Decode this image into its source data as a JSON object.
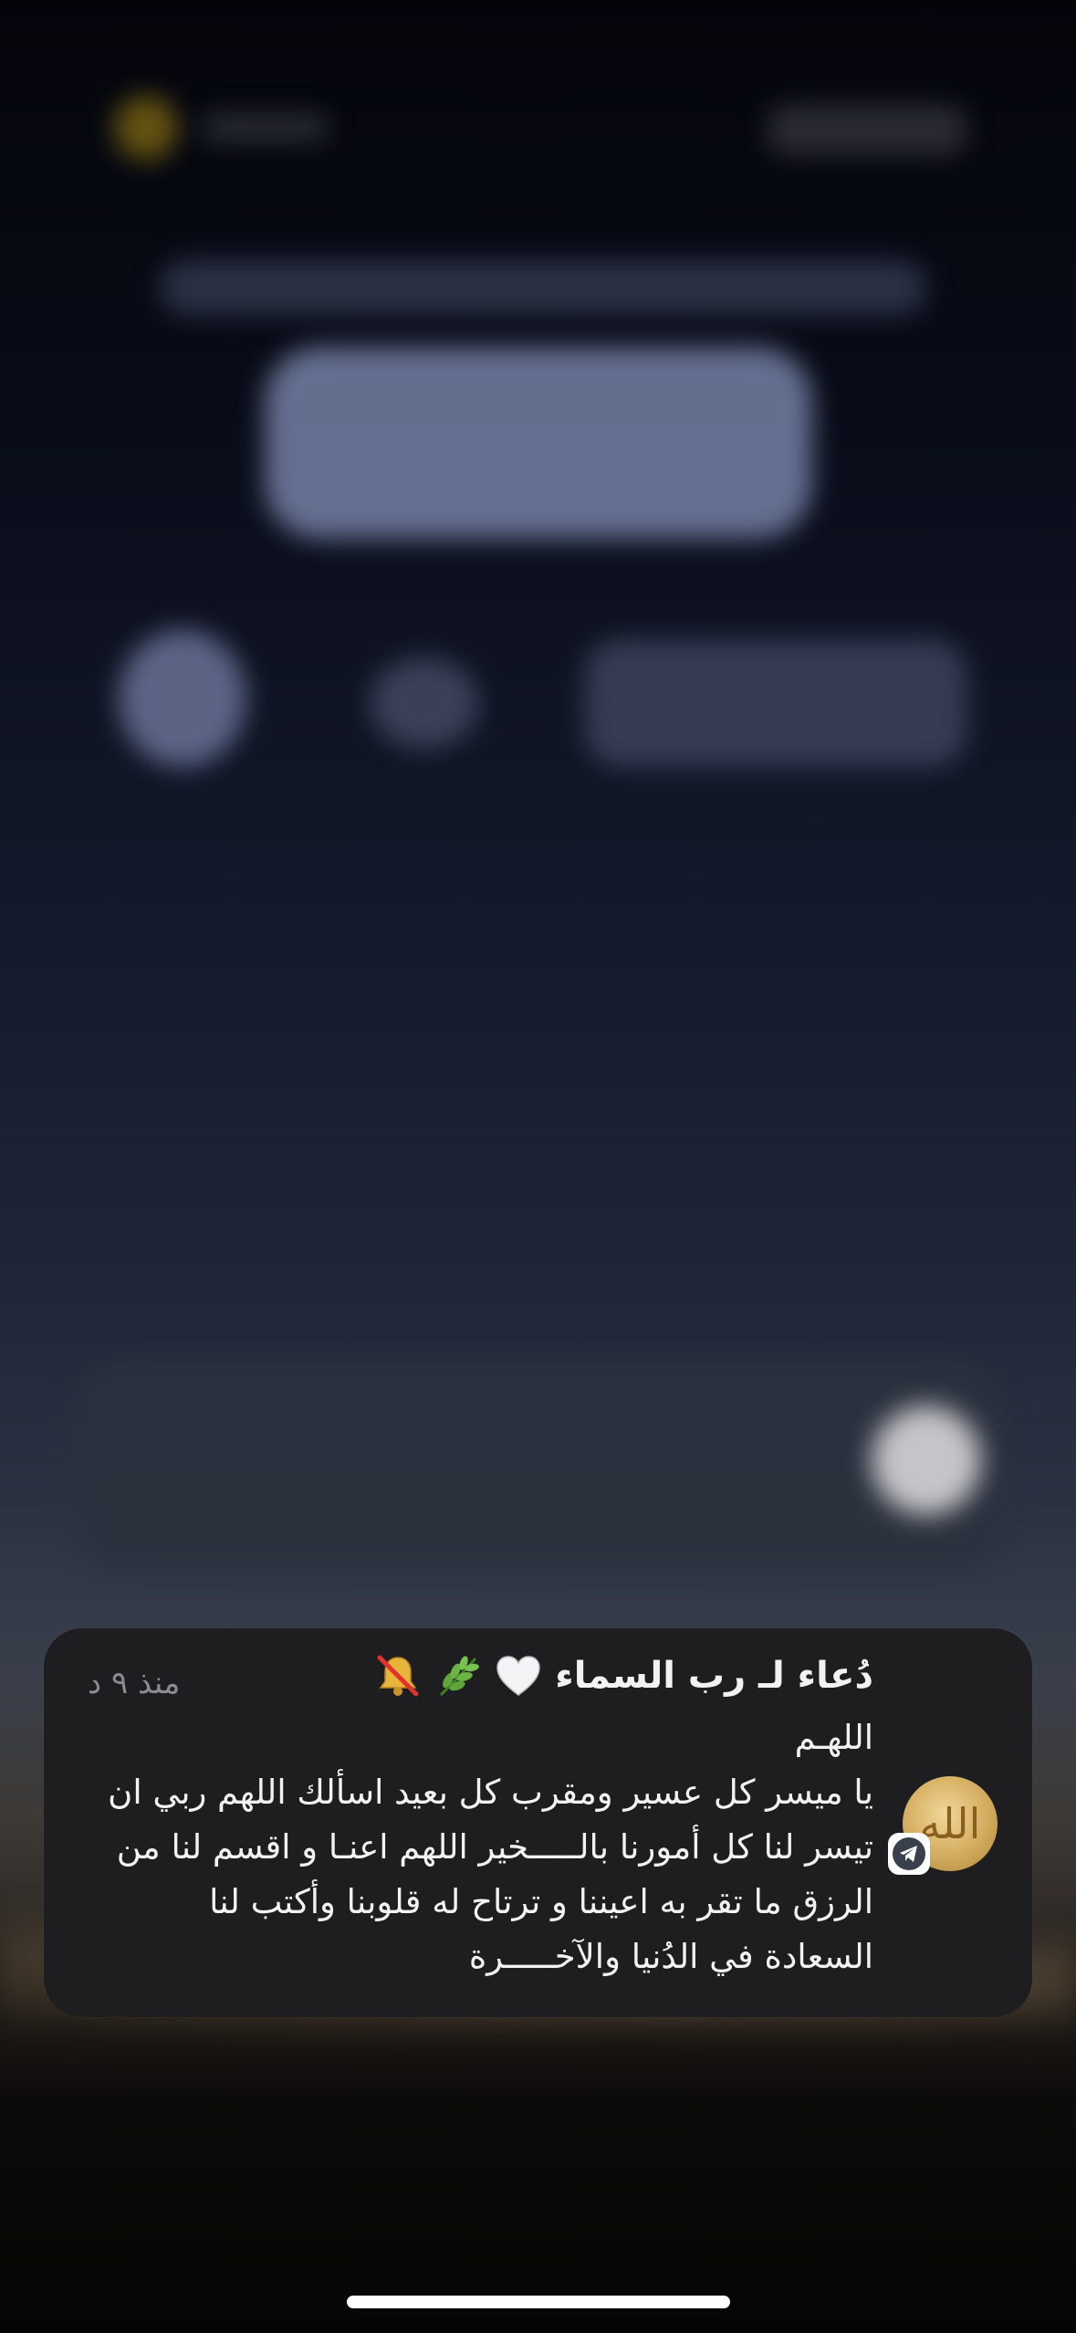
{
  "lock_screen": {
    "background_colors": {
      "top": "#04050b",
      "mid": "#1f2638",
      "bottom": "#050505"
    }
  },
  "notification": {
    "title": "دُعاء لـ رب السماء",
    "title_emojis": [
      "white-heart-icon",
      "herb-icon",
      "bell-muted-icon"
    ],
    "time": "منذ ٩ د",
    "body_lines": [
      "اللهـم",
      "يا ميسر كل عسير ومقرب كل بعيد اسألك اللهم ربي ان",
      "تيسر لنا كل أمورنا بالـــــخير اللهم اعنـا و اقسم لنا من",
      "الرزق ما تقر به اعيننا و ترتاح له قلوبنا وأكتب لنا",
      "السعادة في الدُنيا والآخـــــرة"
    ],
    "avatar_glyph": "الله",
    "app_badge": "telegram-icon",
    "colors": {
      "card": "#1e1e20",
      "text": "#f2f2f4",
      "time": "#8b8b90"
    }
  }
}
